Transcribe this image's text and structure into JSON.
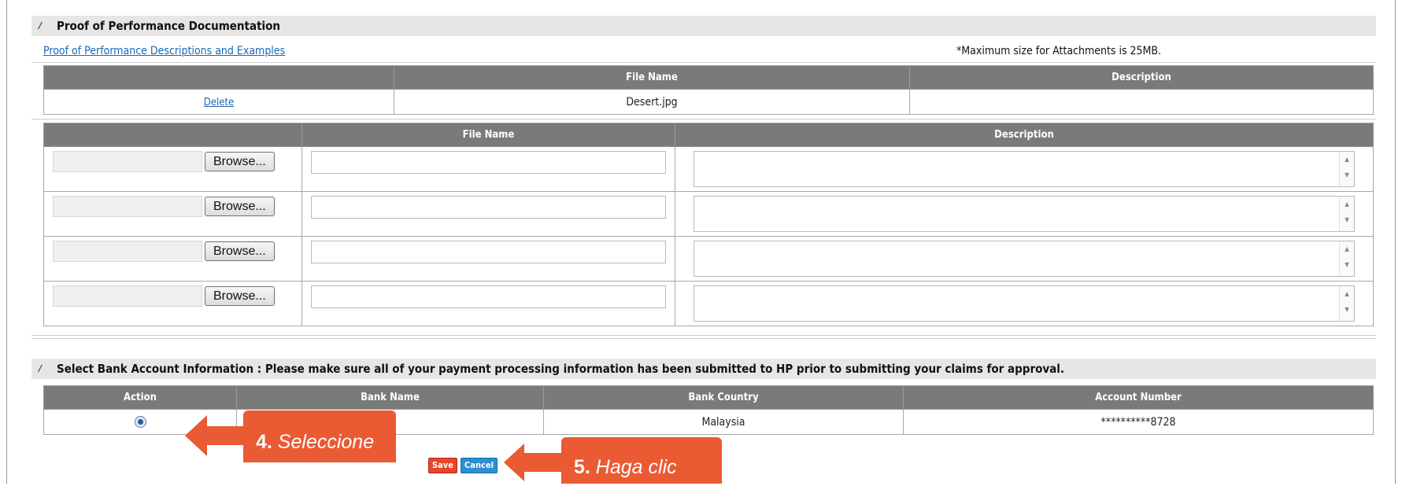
{
  "proof": {
    "section_title": "Proof of Performance Documentation",
    "toggle_glyph": "⁄",
    "link_text": "Proof of Performance Descriptions and Examples",
    "max_size_note": "*Maximum size for Attachments is 25MB.",
    "existing_table": {
      "headers": [
        "",
        "File Name",
        "Description"
      ],
      "row": {
        "action": "Delete",
        "file_name": "Desert.jpg",
        "description": ""
      }
    },
    "upload_table": {
      "headers": [
        "",
        "File Name",
        "Description"
      ],
      "browse_label": "Browse...",
      "row_count": 4
    }
  },
  "bank": {
    "section_title": "Select Bank Account Information : Please make sure all of your payment processing information has been submitted to HP prior to submitting your claims for approval.",
    "headers": [
      "Action",
      "Bank Name",
      "Bank Country",
      "Account Number"
    ],
    "row": {
      "bank_name": "",
      "bank_country": "Malaysia",
      "account_number": "**********8728",
      "selected": true
    }
  },
  "buttons": {
    "save": "Save",
    "cancel": "Cancel"
  },
  "callouts": {
    "step4_number": "4.",
    "step4_text": " Seleccione",
    "step5_number": "5.",
    "step5_text": " Haga clic"
  },
  "colors": {
    "header_bg": "#7a7a7a",
    "section_bg": "#e6e6e6",
    "link": "#1a66b8",
    "callout": "#ea5a33",
    "save_btn": "#e8452c",
    "cancel_btn": "#2b8fd1"
  }
}
